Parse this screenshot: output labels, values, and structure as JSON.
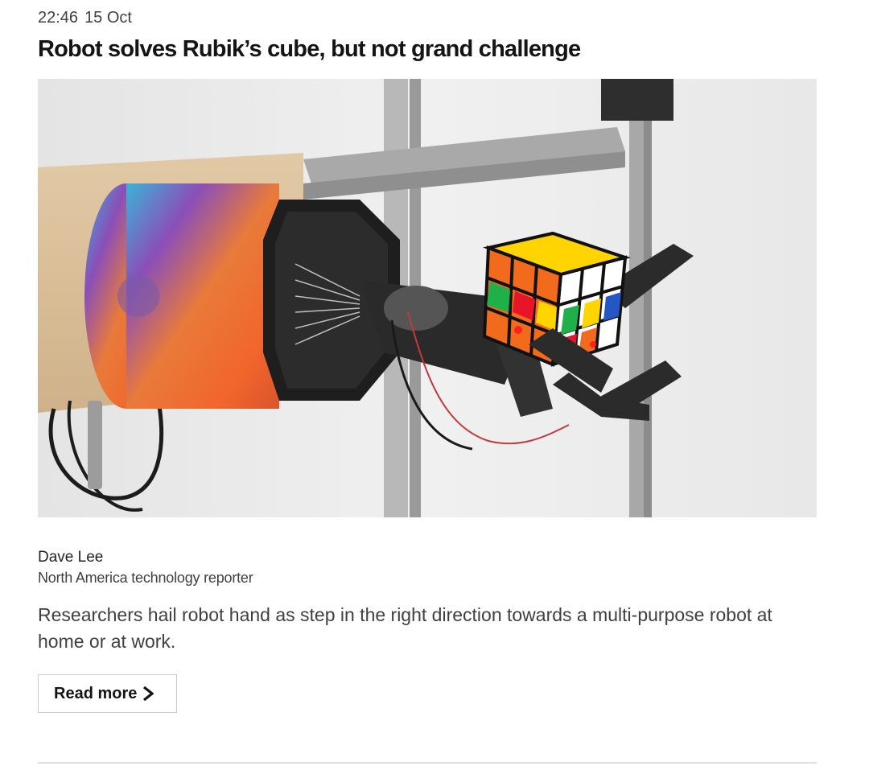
{
  "article": {
    "time": "22:46",
    "date": "15 Oct",
    "headline": "Robot solves Rubik’s cube, but not grand challenge",
    "image_alt": "Robot hand holding a Rubik's cube",
    "author_name": "Dave Lee",
    "author_role": "North America technology reporter",
    "summary": "Researchers hail robot hand as step in the right direction towards a multi-purpose robot at home or at work.",
    "read_more_label": "Read more"
  },
  "icons": {
    "read_more": "chevron-right-icon"
  },
  "colors": {
    "headline": "#141414",
    "body_text": "#404040",
    "button_border": "#cccccc",
    "divider": "#e0e0e0"
  }
}
